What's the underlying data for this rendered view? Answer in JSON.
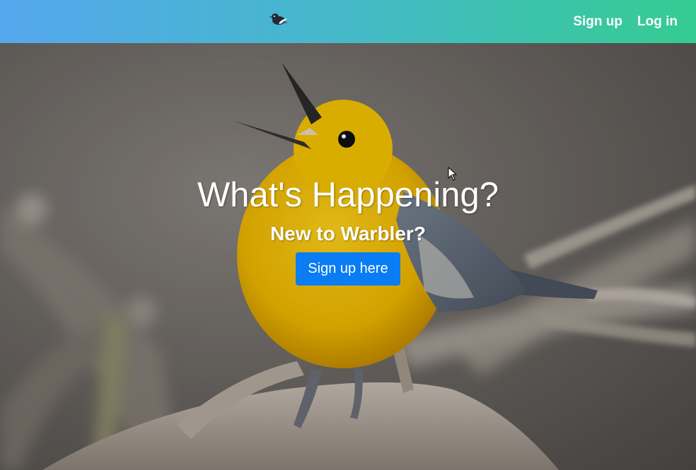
{
  "navbar": {
    "brand_icon": "bird-logo-icon",
    "links": [
      {
        "label": "Sign up"
      },
      {
        "label": "Log in"
      }
    ],
    "gradient": [
      "#55a7ee",
      "#35cc92"
    ]
  },
  "hero": {
    "background_icon": "yellow-warbler-photo",
    "title": "What's Happening?",
    "subtitle": "New to Warbler?",
    "cta_label": "Sign up here",
    "cta_color": "#0a7cf4"
  },
  "cursor": {
    "icon": "mouse-pointer-icon"
  }
}
